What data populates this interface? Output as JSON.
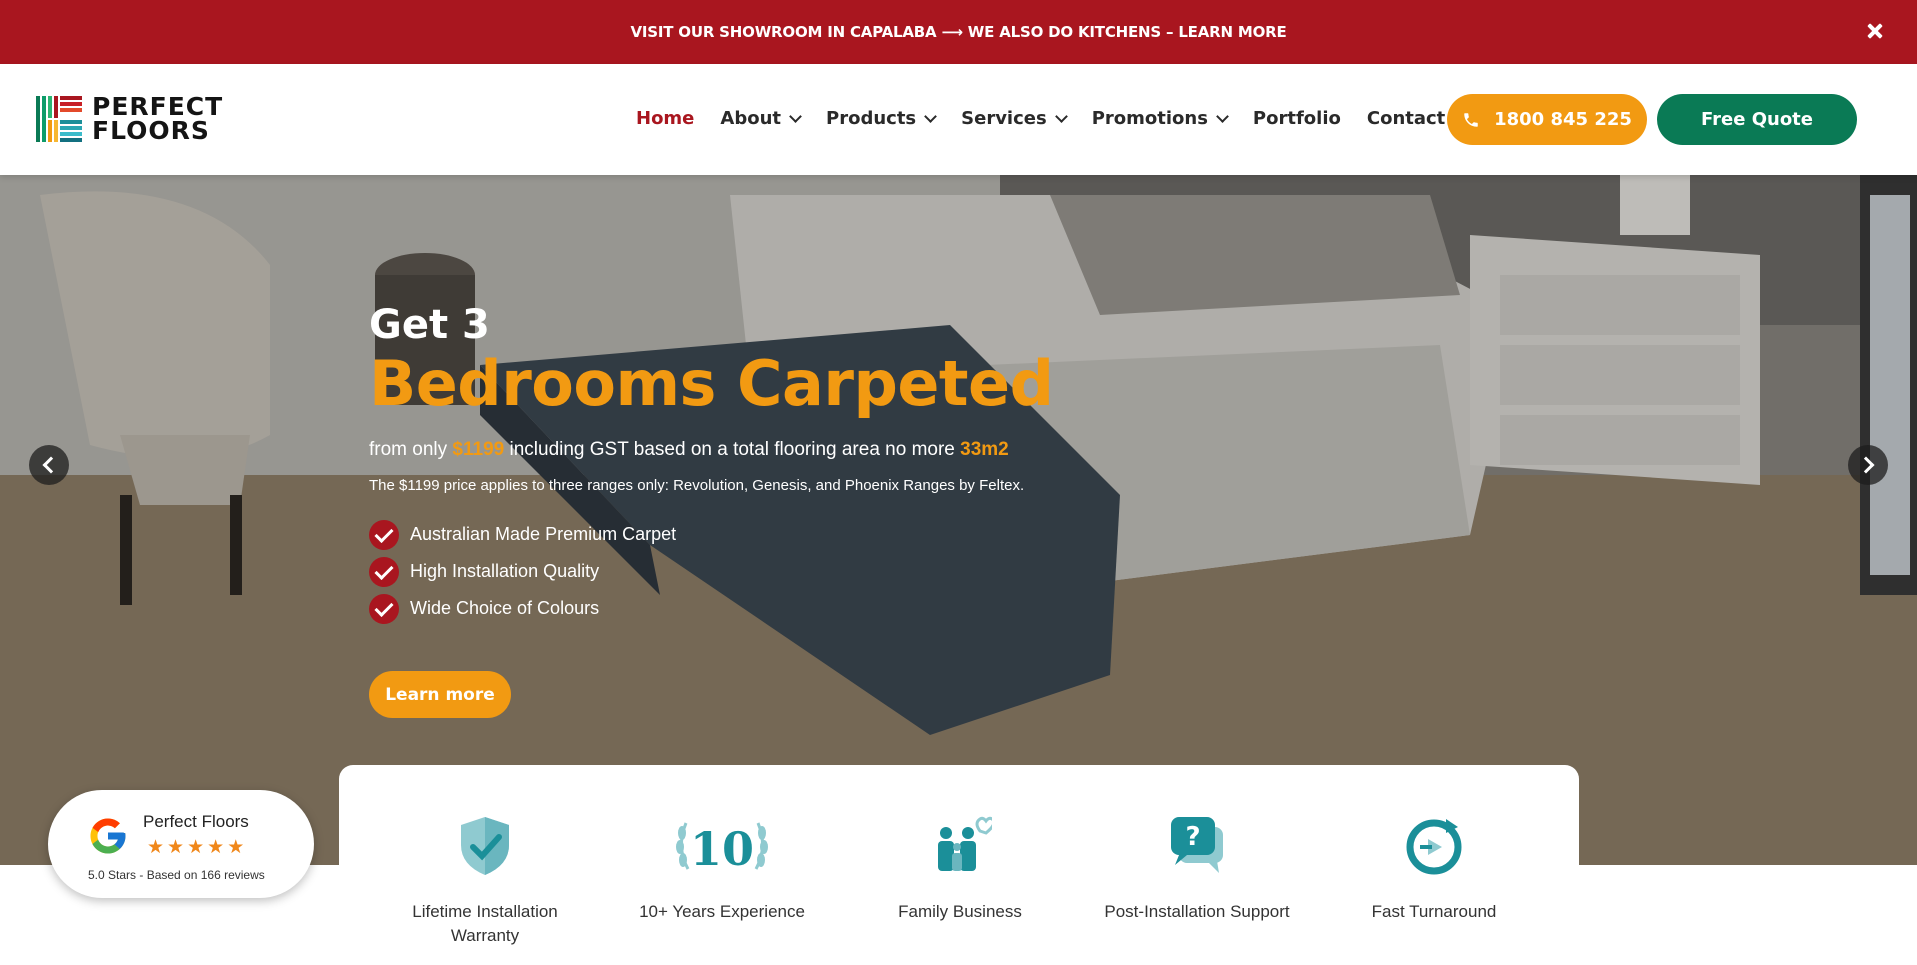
{
  "announcement": {
    "text": "VISIT OUR SHOWROOM IN CAPALABA ⟶ WE ALSO DO KITCHENS – LEARN MORE",
    "close_icon": "close-icon"
  },
  "brand": {
    "line1": "PERFECT",
    "line2": "FLOORS"
  },
  "nav": [
    {
      "label": "Home",
      "active": true,
      "dropdown": false
    },
    {
      "label": "About",
      "active": false,
      "dropdown": true
    },
    {
      "label": "Products",
      "active": false,
      "dropdown": true
    },
    {
      "label": "Services",
      "active": false,
      "dropdown": true
    },
    {
      "label": "Promotions",
      "active": false,
      "dropdown": true
    },
    {
      "label": "Portfolio",
      "active": false,
      "dropdown": false
    },
    {
      "label": "Contact",
      "active": false,
      "dropdown": false
    }
  ],
  "header_buttons": {
    "phone": "1800 845 225",
    "quote": "Free Quote"
  },
  "hero": {
    "pre_title": "Get 3",
    "title": "Bedrooms Carpeted",
    "sub_from": "from only ",
    "sub_price": "$1199",
    "sub_mid": " including GST based on a total flooring area no more ",
    "sub_area": "33m2",
    "note": "The $1199 price applies to three ranges only: Revolution, Genesis, and Phoenix Ranges by Feltex.",
    "checks": [
      "Australian Made Premium Carpet",
      "High Installation Quality",
      "Wide Choice of Colours"
    ],
    "cta": "Learn more"
  },
  "features": [
    {
      "label": "Lifetime Installation Warranty",
      "icon": "shield-check-icon"
    },
    {
      "label": "10+ Years Experience",
      "icon": "ten-years-laurel-icon",
      "icon_text": "10"
    },
    {
      "label": "Family Business",
      "icon": "family-heart-icon"
    },
    {
      "label": "Post-Installation Support",
      "icon": "question-chat-icon"
    },
    {
      "label": "Fast Turnaround",
      "icon": "fast-turnaround-icon"
    }
  ],
  "review": {
    "name": "Perfect Floors",
    "stars": 5,
    "meta": "5.0 Stars - Based on 166 reviews"
  },
  "colors": {
    "brand_red": "#a9161f",
    "orange": "#f29a12",
    "green": "#0a7a55",
    "teal": "#1b8f99"
  }
}
